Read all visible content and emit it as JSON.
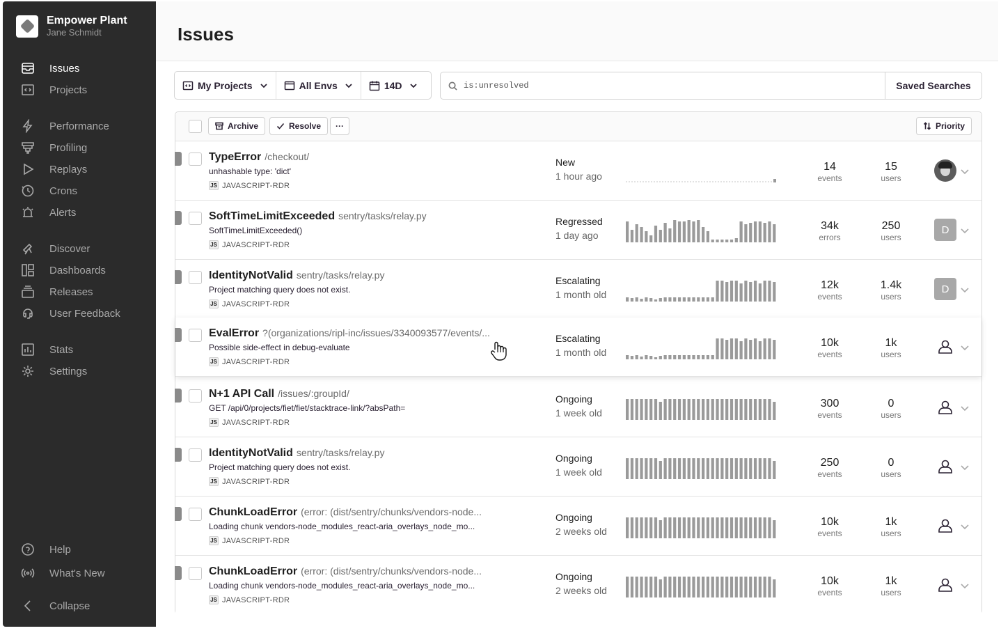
{
  "org": {
    "name": "Empower Plant",
    "user": "Jane Schmidt"
  },
  "nav": {
    "primary": [
      {
        "label": "Issues",
        "icon": "issues-icon",
        "active": true
      },
      {
        "label": "Projects",
        "icon": "projects-icon"
      }
    ],
    "insights": [
      {
        "label": "Performance",
        "icon": "performance-icon"
      },
      {
        "label": "Profiling",
        "icon": "profiling-icon"
      },
      {
        "label": "Replays",
        "icon": "replays-icon"
      },
      {
        "label": "Crons",
        "icon": "crons-icon"
      },
      {
        "label": "Alerts",
        "icon": "alerts-icon"
      }
    ],
    "explore": [
      {
        "label": "Discover",
        "icon": "discover-icon"
      },
      {
        "label": "Dashboards",
        "icon": "dashboards-icon"
      },
      {
        "label": "Releases",
        "icon": "releases-icon"
      },
      {
        "label": "User Feedback",
        "icon": "user-feedback-icon"
      }
    ],
    "admin": [
      {
        "label": "Stats",
        "icon": "stats-icon"
      },
      {
        "label": "Settings",
        "icon": "settings-icon"
      }
    ],
    "footer": [
      {
        "label": "Help",
        "icon": "help-icon"
      },
      {
        "label": "What's New",
        "icon": "broadcast-icon"
      },
      {
        "label": "Collapse",
        "icon": "collapse-icon"
      }
    ]
  },
  "page": {
    "title": "Issues"
  },
  "filters": {
    "projects": "My Projects",
    "envs": "All Envs",
    "period": "14D"
  },
  "search": {
    "value": "is:unresolved",
    "saved_label": "Saved Searches"
  },
  "toolbar": {
    "archive": "Archive",
    "resolve": "Resolve",
    "more": "···",
    "sort": "Priority"
  },
  "issues": [
    {
      "type": "TypeError",
      "culprit": "/checkout/",
      "message": "unhashable type: 'dict'",
      "project": "JAVASCRIPT-RDR",
      "status": "New",
      "age": "1 hour ago",
      "count": "14",
      "count_label": "events",
      "users": "15",
      "users_label": "users",
      "assignee": "photo",
      "spark": [
        0,
        0,
        0,
        0,
        0,
        0,
        0,
        0,
        0,
        0,
        0,
        0,
        0,
        0,
        0,
        0,
        0,
        0,
        0,
        0,
        0,
        0,
        0,
        0,
        0,
        0,
        0,
        0,
        0,
        0,
        0,
        0,
        0,
        0,
        0,
        0,
        0,
        0,
        0,
        0,
        0,
        0,
        0,
        0,
        0,
        0,
        0,
        0,
        0,
        0,
        0,
        0,
        0,
        0,
        4
      ]
    },
    {
      "type": "SoftTimeLimitExceeded",
      "culprit": "sentry/tasks/relay.py",
      "message": "SoftTimeLimitExceeded()",
      "project": "JAVASCRIPT-RDR",
      "status": "Regressed",
      "age": "1 day ago",
      "count": "34k",
      "count_label": "errors",
      "users": "250",
      "users_label": "users",
      "assignee": "D",
      "spark": [
        30,
        18,
        26,
        22,
        16,
        10,
        24,
        18,
        28,
        20,
        34,
        30,
        30,
        32,
        30,
        34,
        22,
        16,
        4,
        4,
        4,
        4,
        4,
        6,
        30,
        26,
        28,
        30,
        30,
        28,
        30,
        26
      ]
    },
    {
      "type": "IdentityNotValid",
      "culprit": "sentry/tasks/relay.py",
      "message": "Project matching query does not exist.",
      "project": "JAVASCRIPT-RDR",
      "status": "Escalating",
      "age": "1 month old",
      "count": "12k",
      "count_label": "events",
      "users": "1.4k",
      "users_label": "users",
      "assignee": "D",
      "spark": [
        6,
        5,
        6,
        4,
        6,
        5,
        3,
        5,
        6,
        6,
        6,
        6,
        6,
        6,
        6,
        6,
        6,
        6,
        6,
        30,
        30,
        28,
        30,
        30,
        26,
        30,
        28,
        30,
        26,
        30,
        30,
        28
      ]
    },
    {
      "type": "EvalError",
      "culprit": "?(organizations/ripl-inc/issues/3340093577/events/...",
      "message": "Possible side-effect in debug-evaluate",
      "project": "JAVASCRIPT-RDR",
      "status": "Escalating",
      "age": "1 month old",
      "count": "10k",
      "count_label": "events",
      "users": "1k",
      "users_label": "users",
      "assignee": "person",
      "spark": [
        6,
        5,
        6,
        4,
        6,
        5,
        3,
        5,
        6,
        6,
        6,
        6,
        6,
        6,
        6,
        6,
        6,
        6,
        6,
        30,
        30,
        28,
        30,
        30,
        26,
        30,
        28,
        30,
        26,
        30,
        30,
        28
      ]
    },
    {
      "type": "N+1 API Call",
      "culprit": "/issues/:groupId/",
      "message": "GET /api/0/projects/fiet/fiet/stacktrace-link/?absPath=",
      "project": "JAVASCRIPT-RDR",
      "status": "Ongoing",
      "age": "1 week old",
      "count": "300",
      "count_label": "events",
      "users": "0",
      "users_label": "users",
      "assignee": "person",
      "spark": [
        30,
        30,
        30,
        30,
        30,
        30,
        30,
        26,
        30,
        30,
        30,
        30,
        30,
        30,
        30,
        30,
        30,
        30,
        30,
        30,
        30,
        30,
        30,
        30,
        30,
        30,
        30,
        30,
        30,
        30,
        30,
        26
      ]
    },
    {
      "type": "IdentityNotValid",
      "culprit": "sentry/tasks/relay.py",
      "message": "Project matching query does not exist.",
      "project": "JAVASCRIPT-RDR",
      "status": "Ongoing",
      "age": "1 week old",
      "count": "250",
      "count_label": "events",
      "users": "0",
      "users_label": "users",
      "assignee": "person",
      "spark": [
        30,
        30,
        30,
        30,
        30,
        30,
        30,
        26,
        30,
        30,
        30,
        30,
        30,
        30,
        30,
        30,
        30,
        30,
        30,
        30,
        30,
        30,
        30,
        30,
        30,
        30,
        30,
        30,
        30,
        30,
        30,
        26
      ]
    },
    {
      "type": "ChunkLoadError",
      "culprit": "(error: (dist/sentry/chunks/vendors-node...",
      "message": "Loading chunk vendors-node_modules_react-aria_overlays_node_mo...",
      "project": "JAVASCRIPT-RDR",
      "status": "Ongoing",
      "age": "2 weeks old",
      "count": "10k",
      "count_label": "events",
      "users": "1k",
      "users_label": "users",
      "assignee": "person",
      "spark": [
        30,
        30,
        30,
        30,
        30,
        30,
        30,
        26,
        30,
        30,
        30,
        30,
        30,
        30,
        30,
        30,
        30,
        30,
        30,
        30,
        30,
        30,
        30,
        30,
        30,
        30,
        30,
        30,
        30,
        30,
        30,
        26
      ]
    },
    {
      "type": "ChunkLoadError",
      "culprit": "(error: (dist/sentry/chunks/vendors-node...",
      "message": "Loading chunk vendors-node_modules_react-aria_overlays_node_mo...",
      "project": "JAVASCRIPT-RDR",
      "status": "Ongoing",
      "age": "2 weeks old",
      "count": "10k",
      "count_label": "events",
      "users": "1k",
      "users_label": "users",
      "assignee": "person",
      "spark": [
        30,
        30,
        30,
        30,
        30,
        30,
        30,
        26,
        30,
        30,
        30,
        30,
        30,
        30,
        30,
        30,
        30,
        30,
        30,
        30,
        30,
        30,
        30,
        30,
        30,
        30,
        30,
        30,
        30,
        30,
        30,
        26
      ]
    }
  ],
  "colors": {
    "sidebar": "#2b2b2b",
    "spark_bar": "#9a9a9a",
    "stripe": "#8a8a8a"
  }
}
